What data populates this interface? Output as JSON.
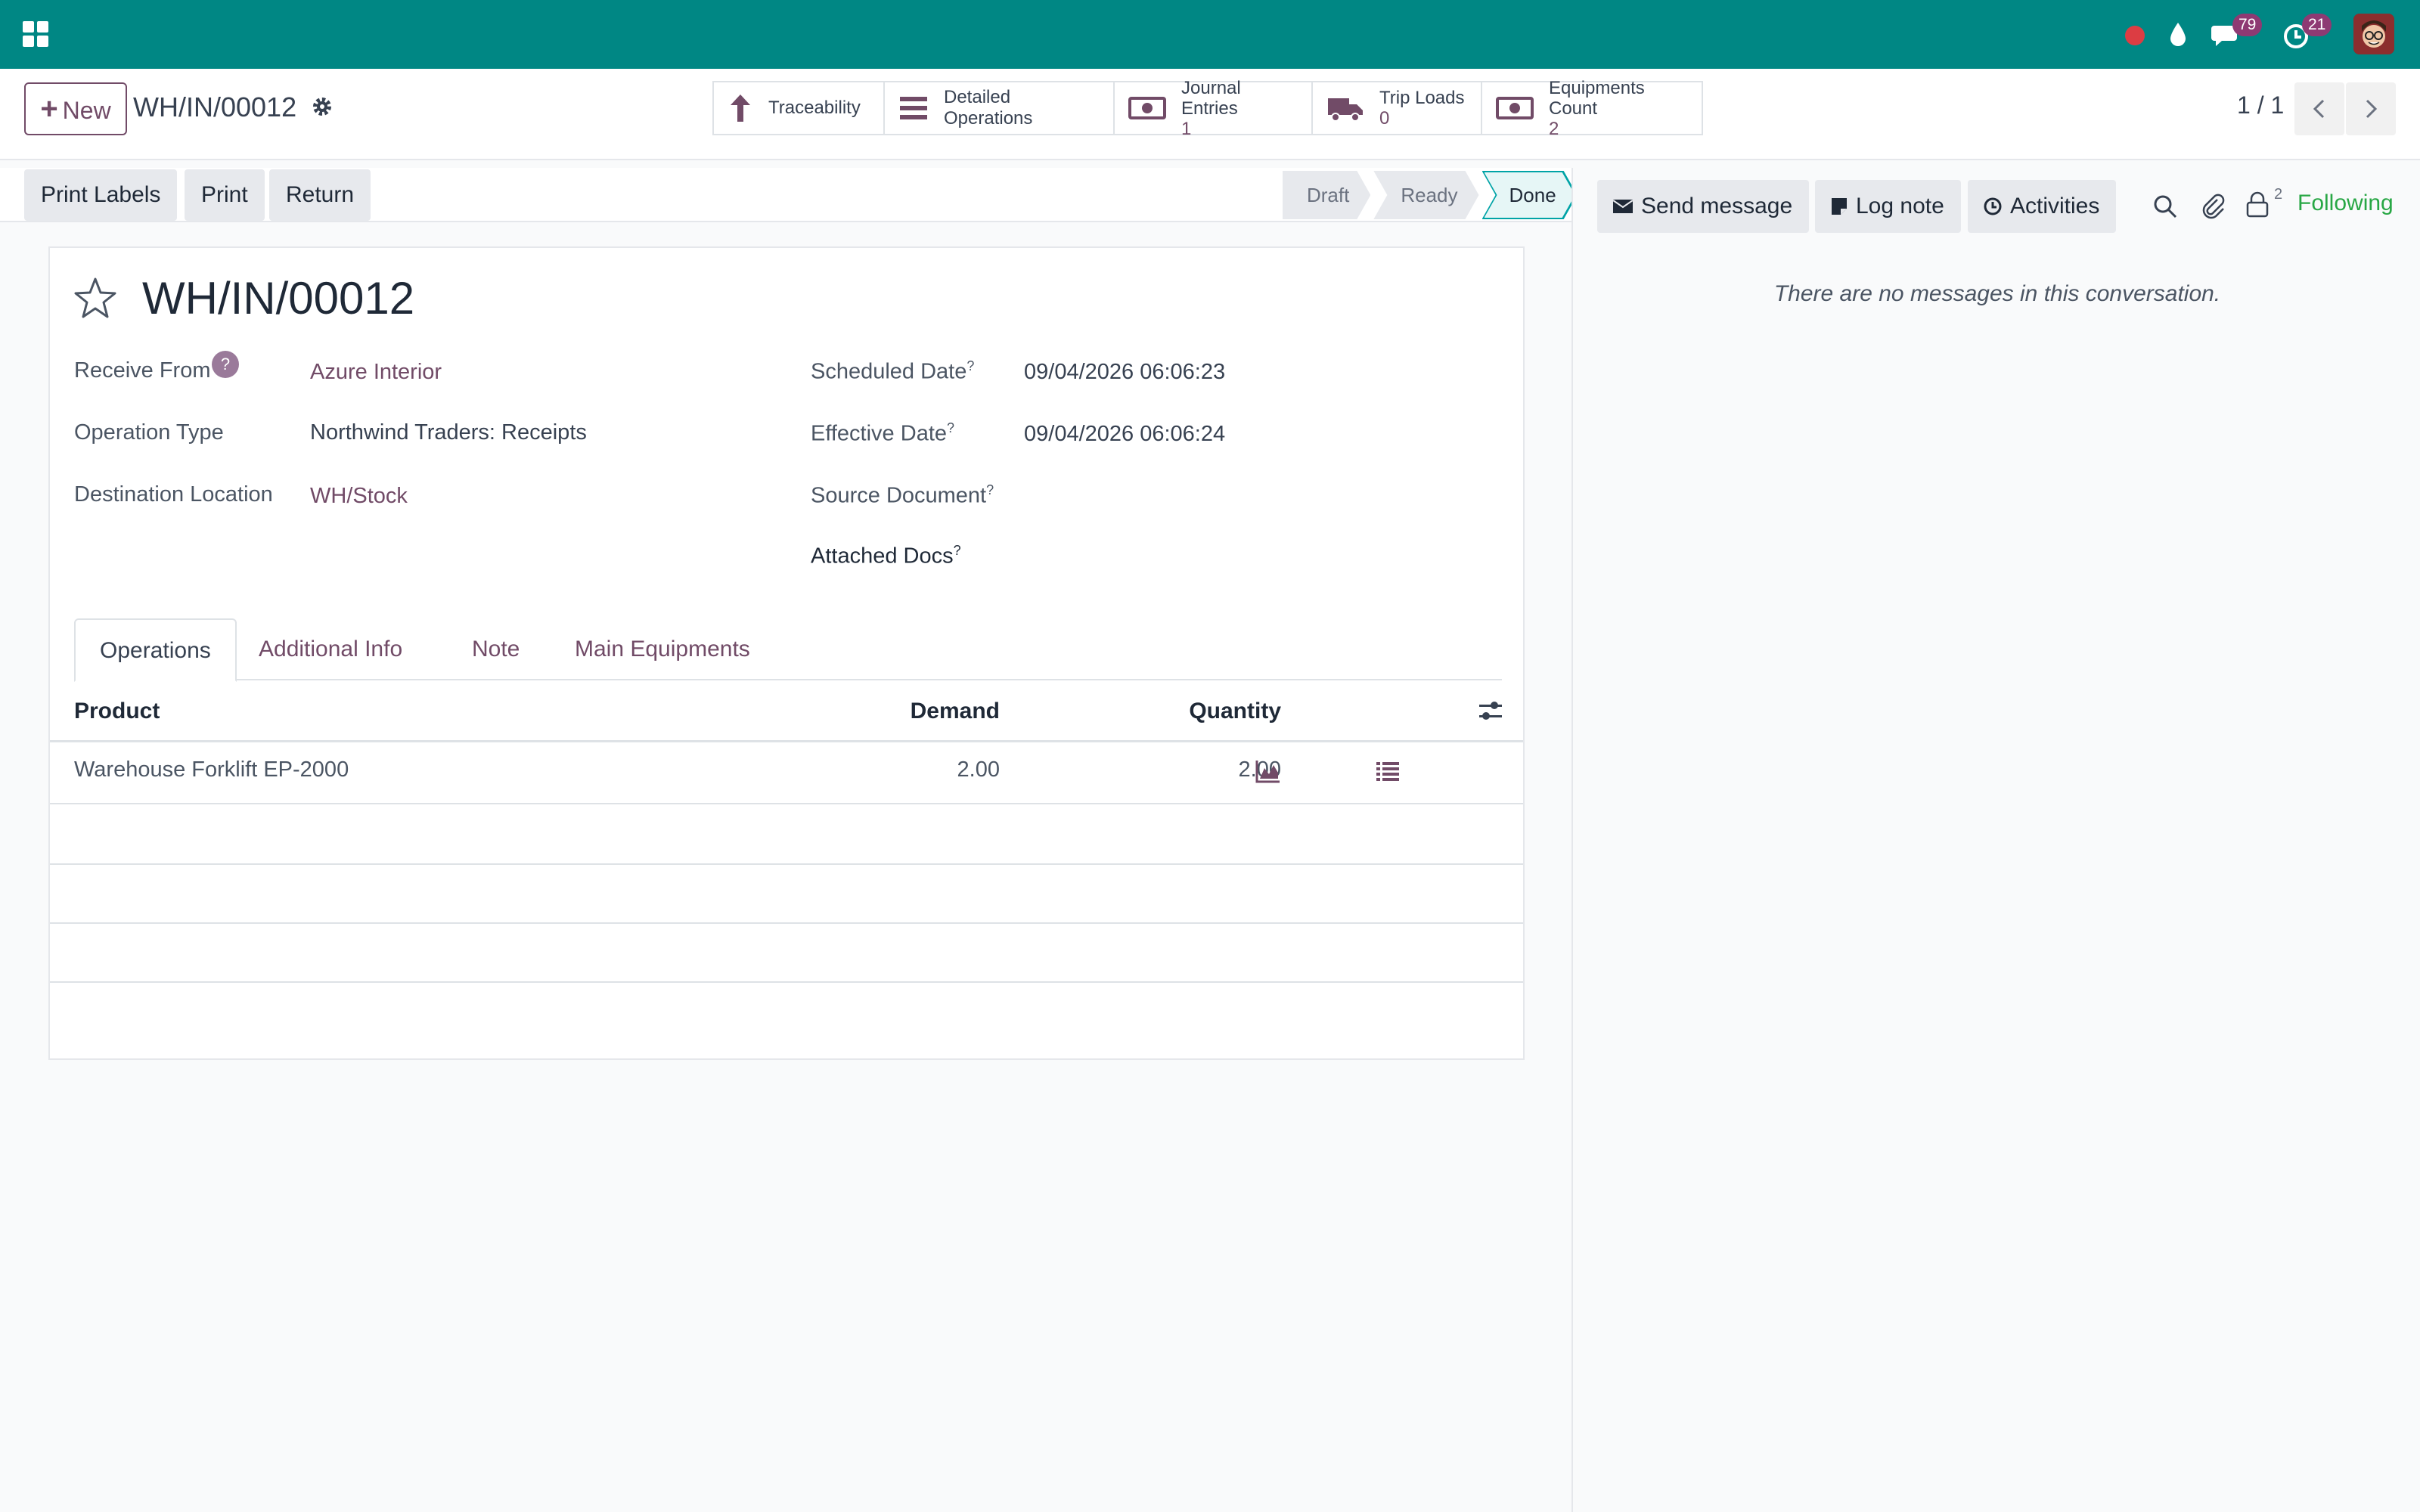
{
  "navbar": {
    "messages_count": "79",
    "activities_count": "21"
  },
  "control_panel": {
    "new_label": "New",
    "breadcrumb": "WH/IN/00012",
    "pager": "1 / 1",
    "smart_buttons": {
      "traceability": "Traceability",
      "detailed_operations": "Detailed Operations",
      "journal_entries": "Journal Entries",
      "journal_entries_count": "1",
      "trip_loads": "Trip Loads",
      "trip_loads_count": "0",
      "equipments_count": "Equipments Count",
      "equipments_count_value": "2"
    }
  },
  "actions": {
    "print_labels": "Print Labels",
    "print": "Print",
    "return": "Return"
  },
  "statusbar": {
    "stages": [
      "Draft",
      "Ready",
      "Done"
    ],
    "current": "Done"
  },
  "form": {
    "title": "WH/IN/00012",
    "receive_from_label": "Receive From",
    "receive_from_help": "?",
    "receive_from": "Azure Interior",
    "operation_type_label": "Operation Type",
    "operation_type": "Northwind Traders: Receipts",
    "destination_label": "Destination Location",
    "destination": "WH/Stock",
    "scheduled_date_label": "Scheduled Date",
    "scheduled_date": "09/04/2026 06:06:23",
    "effective_date_label": "Effective Date",
    "effective_date": "09/04/2026 06:06:24",
    "source_document_label": "Source Document",
    "attached_docs_label": "Attached Docs",
    "help_mark": "?"
  },
  "tabs": [
    "Operations",
    "Additional Info",
    "Note",
    "Main Equipments"
  ],
  "operations_table": {
    "columns": {
      "product": "Product",
      "demand": "Demand",
      "quantity": "Quantity"
    },
    "rows": [
      {
        "product": "Warehouse Forklift EP-2000",
        "demand": "2.00",
        "quantity": "2.00"
      }
    ]
  },
  "chatter": {
    "send_message": "Send message",
    "log_note": "Log note",
    "activities": "Activities",
    "followers_count": "2",
    "following": "Following",
    "empty_text": "There are no messages in this conversation."
  },
  "colors": {
    "navbar": "#008784",
    "brand": "#714b67",
    "following": "#28a745",
    "done_stage": "#00a3a6"
  },
  "icons": [
    "apps-icon",
    "record-icon",
    "drop-icon",
    "chat-icon",
    "clock-icon",
    "gear-icon",
    "arrow-up-icon",
    "list-icon",
    "money-icon",
    "truck-icon",
    "star-icon",
    "chart-icon",
    "detail-list-icon",
    "optional-columns-icon",
    "envelope-icon",
    "note-icon",
    "clock-icon",
    "search-icon",
    "paperclip-icon",
    "lock-icon",
    "chevron-left-icon",
    "chevron-right-icon"
  ]
}
